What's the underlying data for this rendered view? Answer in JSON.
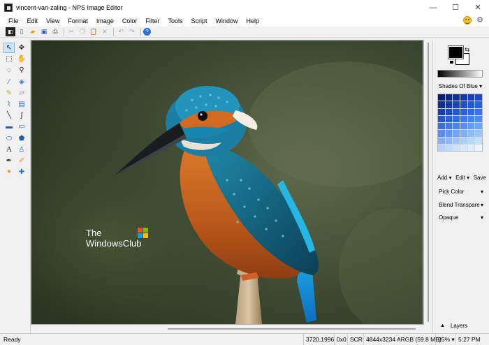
{
  "window": {
    "title": "vincent-van-zaling - NPS Image Editor",
    "minimize_glyph": "—",
    "maximize_glyph": "☐",
    "close_glyph": "✕"
  },
  "menu": [
    "File",
    "Edit",
    "View",
    "Format",
    "Image",
    "Color",
    "Filter",
    "Tools",
    "Script",
    "Window",
    "Help"
  ],
  "toolbar_icons": [
    "select-mode-icon",
    "new-file-icon",
    "open-folder-icon",
    "save-icon",
    "print-icon",
    "cut-icon",
    "copy-icon",
    "paste-icon",
    "delete-icon",
    "undo-icon",
    "redo-icon",
    "help-icon"
  ],
  "toolbox_icons": [
    [
      "pointer-icon",
      "move-icon"
    ],
    [
      "marquee-select-icon",
      "hand-icon"
    ],
    [
      "lasso-icon",
      "zoom-icon"
    ],
    [
      "eyedropper-icon",
      "paint-bucket-icon"
    ],
    [
      "pencil-icon",
      "eraser-icon"
    ],
    [
      "brush-icon",
      "stamp-icon"
    ],
    [
      "line-icon",
      "curve-icon"
    ],
    [
      "rectangle-icon",
      "rounded-rectangle-icon"
    ],
    [
      "ellipse-icon",
      "polygon-icon"
    ],
    [
      "text-icon",
      "clone-icon"
    ],
    [
      "pen-icon",
      "spray-icon"
    ],
    [
      "magic-wand-icon",
      "add-icon"
    ]
  ],
  "canvas": {
    "watermark_line1": "The",
    "watermark_line2": "WindowsClub"
  },
  "colors": {
    "foreground": "#000000",
    "background": "#ffffff",
    "palette": [
      "#0a1e6e",
      "#0d2682",
      "#113096",
      "#1538a8",
      "#1a40b8",
      "#1f48c8",
      "#122e8a",
      "#163a9e",
      "#1b44b2",
      "#2050c4",
      "#2558d4",
      "#2a60e2",
      "#1a3ea8",
      "#1f4abc",
      "#2456ce",
      "#2962de",
      "#306aea",
      "#3772f2",
      "#2854c4",
      "#2e60d4",
      "#356ce2",
      "#3c78ee",
      "#4482f6",
      "#4c8cfa",
      "#3c6ed8",
      "#4478e4",
      "#4c84ee",
      "#5590f6",
      "#609cfa",
      "#6aa6fc",
      "#5c8ce6",
      "#6898ee",
      "#74a4f4",
      "#80b0f8",
      "#8cbcfb",
      "#98c6fd",
      "#86aef0",
      "#92b8f4",
      "#9ec4f7",
      "#aaceF9",
      "#b6d8fb",
      "#c2e0fd",
      "#b8d0f8",
      "#c2d8fa",
      "#cce0fb",
      "#d6e8fc",
      "#e0effd",
      "#eaf5fe"
    ]
  },
  "right_panel": {
    "palette_name": "Shades Of Blue",
    "add_label": "Add",
    "edit_label": "Edit",
    "save_label": "Save",
    "pick_color_label": "Pick Color",
    "blend_label": "Blend Transpare",
    "opacity_label": "Opaque",
    "layers_label": "Layers"
  },
  "status": {
    "ready": "Ready",
    "coords": "3720,1996",
    "selection": "0x0",
    "scr": "SCR",
    "image_info": "4844x3234 ARGB (59.8 MB)",
    "zoom": "25%",
    "time": "5:27 PM"
  }
}
